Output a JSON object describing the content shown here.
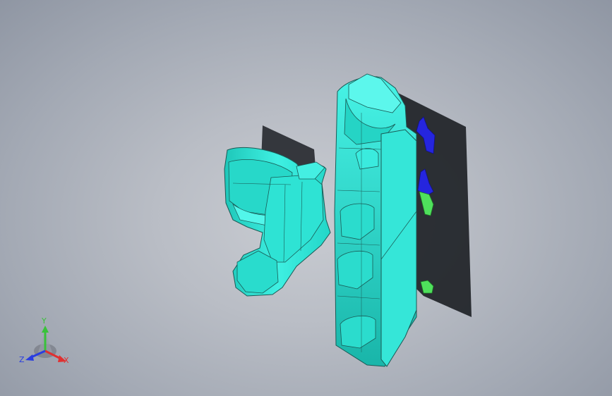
{
  "viewport": {
    "background_color": "#b4b9c1",
    "model_color": "#2ee8d8",
    "model_edge_color": "#1a5a55",
    "accent_part_colors": [
      "#2424e0",
      "#4ae05a"
    ]
  },
  "triad": {
    "y_label": "Y",
    "z_label": "Z",
    "x_label": "X",
    "y_color": "#39c23a",
    "z_color": "#2a3ee0",
    "x_color": "#e03030"
  }
}
